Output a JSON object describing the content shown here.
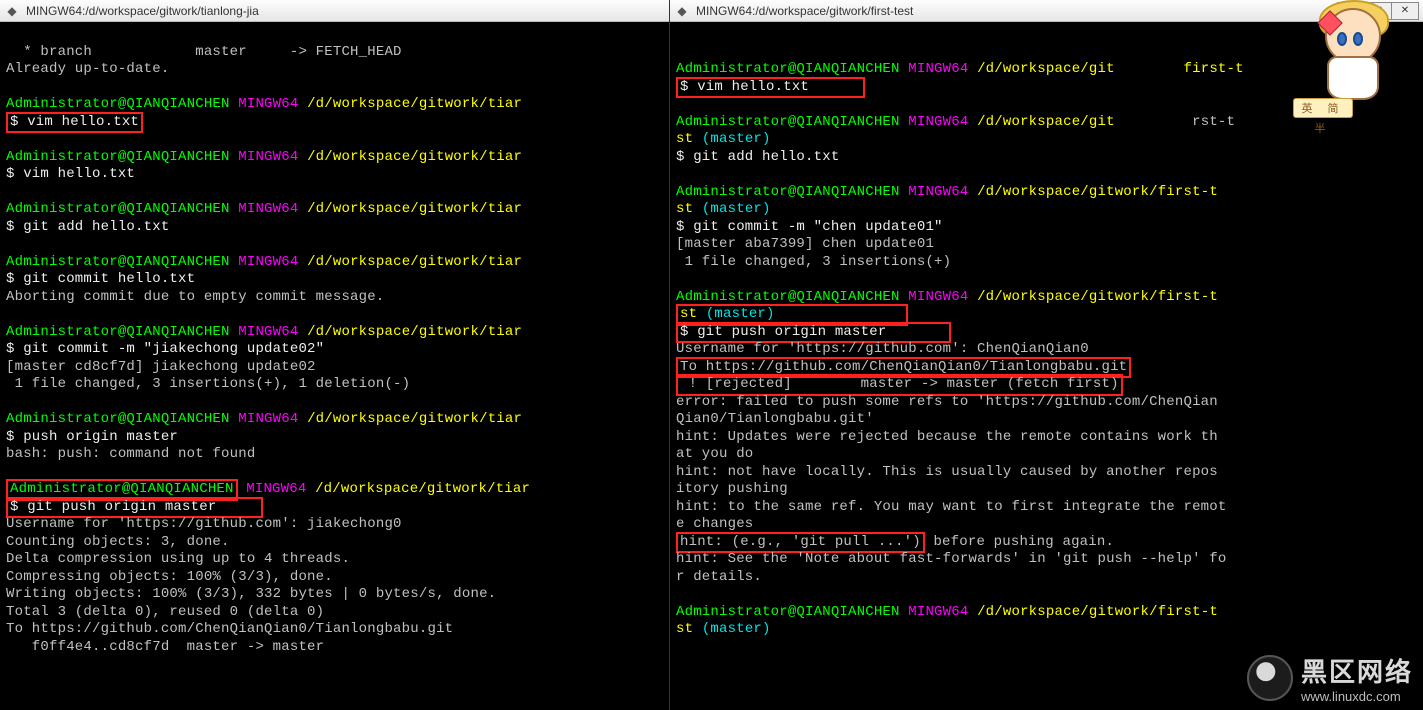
{
  "left": {
    "title": "MINGW64:/d/workspace/gitwork/tianlong-jia",
    "lines": {
      "l0": "  * branch            master     -> FETCH_HEAD",
      "l1": "Already up-to-date.",
      "user": "Administrator@QIANQIANCHEN",
      "host": "MINGW64",
      "path": "/d/workspace/gitwork/tiar",
      "cmd_vim": "$ vim hello.txt",
      "cmd_add": "$ git add hello.txt",
      "cmd_commit1": "$ git commit hello.txt",
      "abort": "Aborting commit due to empty commit message.",
      "cmd_commit2": "$ git commit -m \"jiakechong update02\"",
      "commit_out1": "[master cd8cf7d] jiakechong update02",
      "commit_out2": " 1 file changed, 3 insertions(+), 1 deletion(-)",
      "cmd_pushbad": "$ push origin master",
      "pushbad_out": "bash: push: command not found",
      "cmd_push": "$ git push origin master",
      "push_out1": "Username for 'https://github.com': jiakechong0",
      "push_out2": "Counting objects: 3, done.",
      "push_out3": "Delta compression using up to 4 threads.",
      "push_out4": "Compressing objects: 100% (3/3), done.",
      "push_out5": "Writing objects: 100% (3/3), 332 bytes | 0 bytes/s, done.",
      "push_out6": "Total 3 (delta 0), reused 0 (delta 0)",
      "push_out7": "To https://github.com/ChenQianQian0/Tianlongbabu.git",
      "push_out8": "   f0ff4e4..cd8cf7d  master -> master"
    }
  },
  "right": {
    "title": "MINGW64:/d/workspace/gitwork/first-test",
    "lines": {
      "user": "Administrator@QIANQIANCHEN",
      "host": "MINGW64",
      "path1": "/d/workspace/git",
      "path1b": "first-t",
      "path2": "/d/workspace/gitwork/first-t",
      "branch_pre": "st ",
      "branch": "(master)",
      "cmd_vim": "$ vim hello.txt",
      "cmd_add": "$ git add hello.txt",
      "cmd_commit": "$ git commit -m \"chen update01\"",
      "commit_out1": "[master aba7399] chen update01",
      "commit_out2": " 1 file changed, 3 insertions(+)",
      "cmd_push": "$ git push origin master",
      "push_u1": "Username for 'https://github.com': ChenQianQian0",
      "push_u2": "To https://github.com/ChenQianQian0/Tianlongbabu.git",
      "rejected": " ! [rejected]        master -> master (fetch first)",
      "err1": "error: failed to push some refs to 'https://github.com/ChenQian",
      "err2": "Qian0/Tianlongbabu.git'",
      "hint1": "hint: Updates were rejected because the remote contains work th",
      "hint1b": "at you do",
      "hint2": "hint: not have locally. This is usually caused by another repos",
      "hint2b": "itory pushing",
      "hint3": "hint: to the same ref. You may want to first integrate the remot",
      "hint3b": "e changes",
      "hint4a": "hint: (e.g., 'git pull ...')",
      "hint4b": " before pushing again.",
      "hint5": "hint: See the 'Note about fast-forwards' in 'git push --help' fo",
      "hint5b": "r details."
    }
  },
  "watermark": {
    "cn": "黑区网络",
    "en": "www.linuxdc.com"
  },
  "mascot_tag": "英   简半"
}
